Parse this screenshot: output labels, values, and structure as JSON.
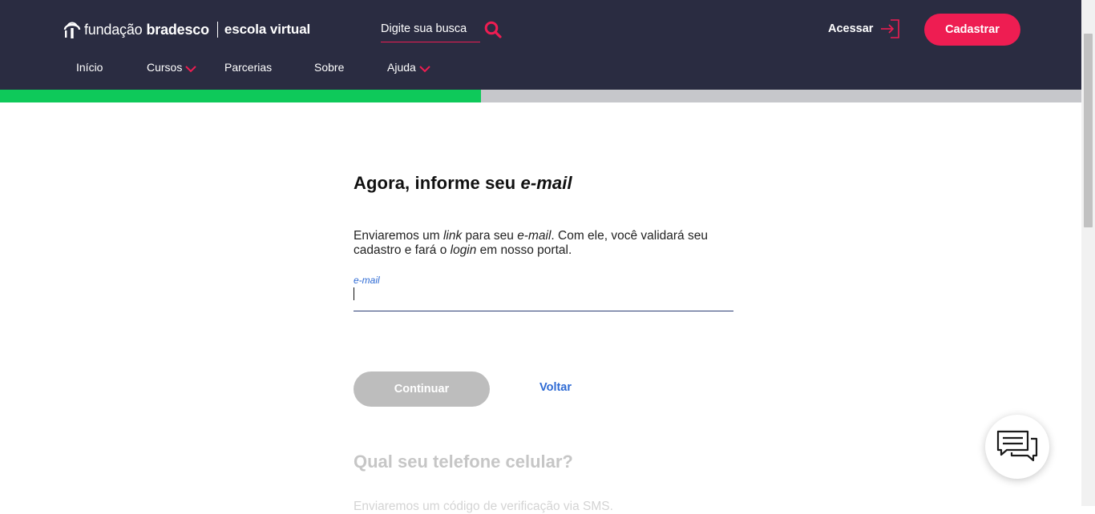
{
  "header": {
    "logo": {
      "part1": "fundação",
      "part2": "bradesco",
      "part3": "escola virtual"
    },
    "search": {
      "placeholder": "Digite sua busca"
    },
    "acessar_label": "Acessar",
    "cadastrar_label": "Cadastrar",
    "nav": [
      {
        "label": "Início",
        "has_dropdown": false
      },
      {
        "label": "Cursos",
        "has_dropdown": true
      },
      {
        "label": "Parcerias",
        "has_dropdown": false
      },
      {
        "label": "Sobre",
        "has_dropdown": false
      },
      {
        "label": "Ajuda",
        "has_dropdown": true
      }
    ]
  },
  "progress": {
    "fraction": 0.445
  },
  "main": {
    "title_prefix": "Agora, informe seu ",
    "title_em": "e-mail",
    "desc": {
      "t1": "Enviaremos um ",
      "em1": "link",
      "t2": " para seu ",
      "em2": "e-mail",
      "t3": ". Com ele, você validará seu cadastro e fará o ",
      "em3": "login",
      "t4": " em nosso portal."
    },
    "email_label": "e-mail",
    "email_value": "",
    "continuar_label": "Continuar",
    "voltar_label": "Voltar",
    "next_title": "Qual seu telefone celular?",
    "next_desc": "Enviaremos um código de verificação via SMS."
  },
  "colors": {
    "header_bg": "#2a2c41",
    "accent": "#ee1d52",
    "progress_fill": "#0ec95a",
    "link_blue": "#2f6bd4"
  },
  "icons": {
    "logo": "bradesco-tree-icon",
    "search": "search-icon",
    "login": "login-door-icon",
    "chevron": "chevron-down-icon",
    "chat": "chat-bubbles-icon"
  }
}
